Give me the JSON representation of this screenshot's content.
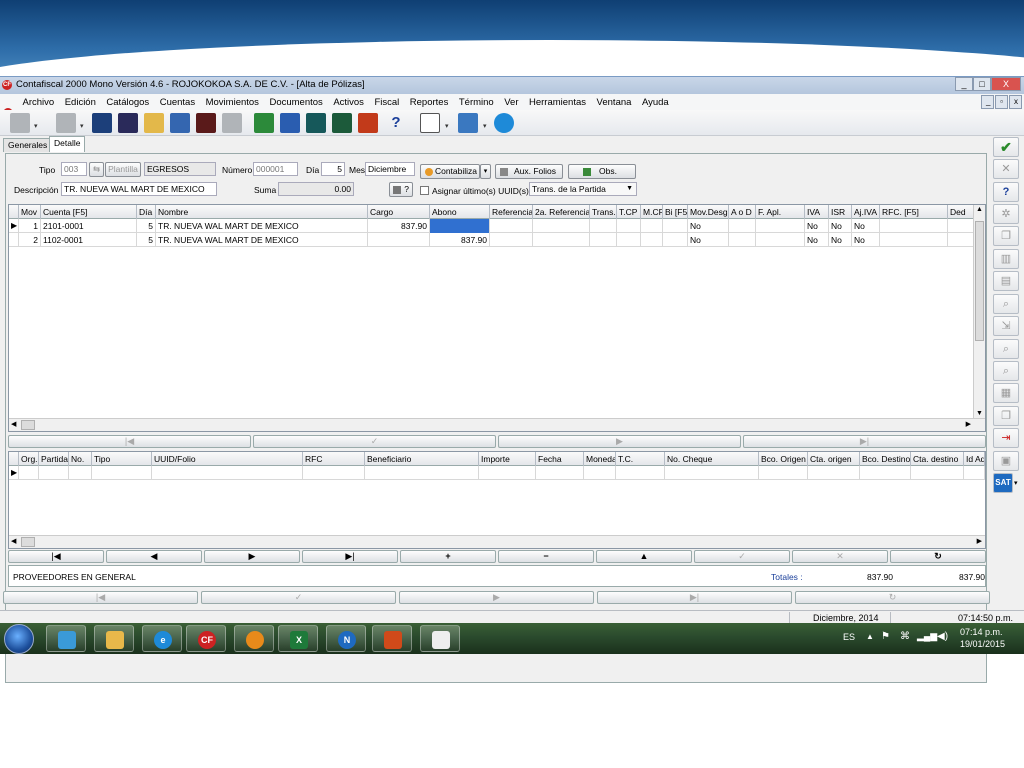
{
  "window": {
    "title": "Contafiscal 2000 Mono Versión 4.6 - ROJOKOKOA S.A. DE C.V. - [Alta de Pólizas]",
    "app_icon": "CF",
    "controls": [
      "_",
      "□",
      "X"
    ],
    "mdi_controls": [
      "_",
      "▫",
      "x"
    ]
  },
  "menu": [
    {
      "label": "Archivo"
    },
    {
      "label": "Edición"
    },
    {
      "label": "Catálogos"
    },
    {
      "label": "Cuentas"
    },
    {
      "label": "Movimientos"
    },
    {
      "label": "Documentos"
    },
    {
      "label": "Activos"
    },
    {
      "label": "Fiscal"
    },
    {
      "label": "Reportes"
    },
    {
      "label": "Término"
    },
    {
      "label": "Ver"
    },
    {
      "label": "Herramientas"
    },
    {
      "label": "Ventana"
    },
    {
      "label": "Ayuda"
    }
  ],
  "toolbar": {
    "icons": [
      "open-icon",
      "new-doc-icon",
      "network-icon",
      "calculator-icon",
      "report-icon",
      "transfer-icon",
      "chart-icon",
      "disabled-icon",
      "excel-icon",
      "word-icon",
      "storage-icon",
      "calc-icon",
      "exit-icon",
      "help-icon",
      "print-preview-icon",
      "color-icon",
      "ie-icon"
    ],
    "help": "?"
  },
  "tabs": [
    {
      "label": "Generales"
    },
    {
      "label": "Detalle"
    }
  ],
  "form": {
    "tipo_label": "Tipo",
    "tipo_value": "003",
    "plantilla_label": "Plantilla",
    "tipo_name": "EGRESOS",
    "numero_label": "Número",
    "numero_value": "000001",
    "dia_label": "Día",
    "dia_value": "5",
    "mes_label": "Mes",
    "mes_value": "Diciembre",
    "descripcion_label": "Descripción",
    "descripcion_value": "TR. NUEVA WAL MART DE MEXICO",
    "suma_label": "Suma",
    "suma_value": "0.00",
    "contabiliza_label": "Contabiliza",
    "aux_folios_label": "Aux. Folios",
    "obs_label": "Obs.",
    "calc_label": "?",
    "asignar_label": "Asignar último(s) UUID(s)",
    "trans_value": "Trans. de la Partida"
  },
  "movimientos": {
    "columns": [
      "Mov",
      "Cuenta [F5]",
      "Día",
      "Nombre",
      "Cargo",
      "Abono",
      "Referencia",
      "2a. Referencia",
      "Trans.",
      "T.CP",
      "M.CP",
      "Bi [F5]",
      "Mov.Desg.",
      "A o D",
      "F. Apl.",
      "IVA",
      "ISR",
      "Aj.IVA",
      "RFC. [F5]",
      "Ded"
    ],
    "rows": [
      {
        "mov": "1",
        "cuenta": "2101-0001",
        "dia": "5",
        "nombre": "TR. NUEVA WAL MART DE MEXICO",
        "cargo": "837.90",
        "abono": "",
        "desg": "No",
        "iva": "No",
        "isr": "No",
        "ajiva": "No"
      },
      {
        "mov": "2",
        "cuenta": "1102-0001",
        "dia": "5",
        "nombre": "TR. NUEVA WAL MART DE MEXICO",
        "cargo": "",
        "abono": "837.90",
        "desg": "No",
        "iva": "No",
        "isr": "No",
        "ajiva": "No"
      }
    ]
  },
  "uuids": {
    "columns": [
      "Org.",
      "Partida",
      "No.",
      "Tipo",
      "UUID/Folio",
      "RFC",
      "Beneficiario",
      "Importe",
      "Fecha",
      "Moneda",
      "T.C.",
      "No. Cheque",
      "Bco. Origen",
      "Cta. origen",
      "Bco. Destino",
      "Cta. destino",
      "Id Ad"
    ]
  },
  "nav": {
    "first": "|◀",
    "prev": "◀",
    "next": "▶",
    "last": "▶|",
    "add": "+",
    "remove": "−",
    "up": "▲",
    "check": "✓",
    "cancel": "✕",
    "refresh": "↻"
  },
  "footer": {
    "proveedor": "PROVEEDORES EN GENERAL",
    "totales_label": "Totales :",
    "total_cargo": "837.90",
    "total_abono": "837.90"
  },
  "status": {
    "period": "Diciembre, 2014",
    "time": "07:14:50 p.m."
  },
  "taskbar": {
    "lang": "ES",
    "clock_time": "07:14 p.m.",
    "clock_date": "19/01/2015",
    "apps": [
      "explorer-icon",
      "folder-icon",
      "ie-icon",
      "contafiscal-icon",
      "pdf-icon",
      "excel-icon",
      "nitro-icon",
      "powerpoint-icon",
      "calculator-icon"
    ]
  },
  "sidebar": {
    "ok": "✔",
    "help": "?",
    "sat": "SAT"
  },
  "colors": {
    "accent": "#2d6ca8",
    "ok_green": "#2a8a2a",
    "selection": "#3070d0"
  }
}
